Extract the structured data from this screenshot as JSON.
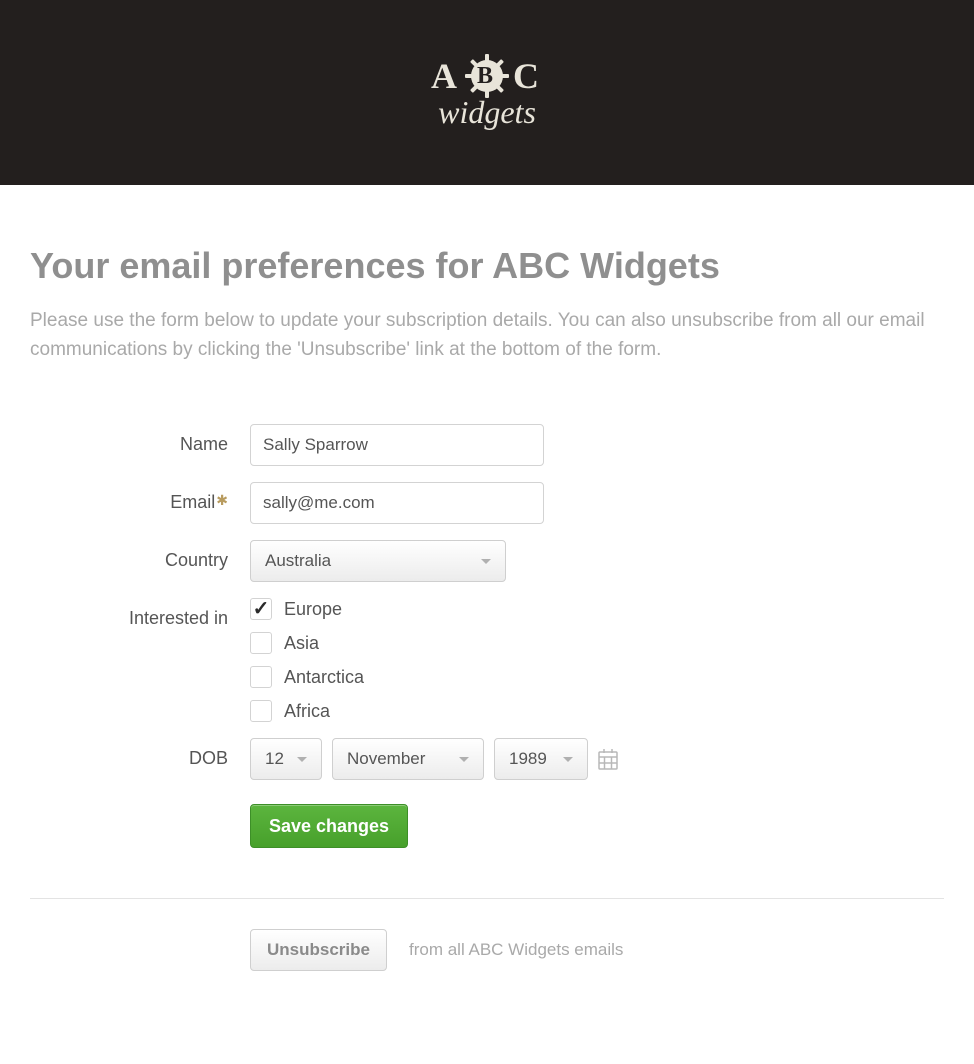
{
  "brand": {
    "line1_a": "A",
    "line1_b": "B",
    "line1_c": "C",
    "line2": "widgets"
  },
  "page": {
    "title": "Your email preferences for ABC Widgets",
    "intro": "Please use the form below to update your subscription details. You can also unsubscribe from all our email communications by clicking the 'Unsubscribe' link at the bottom of the form."
  },
  "form": {
    "name": {
      "label": "Name",
      "value": "Sally Sparrow"
    },
    "email": {
      "label": "Email",
      "value": "sally@me.com",
      "required": true
    },
    "country": {
      "label": "Country",
      "value": "Australia"
    },
    "interests": {
      "label": "Interested in",
      "options": [
        {
          "label": "Europe",
          "checked": true
        },
        {
          "label": "Asia",
          "checked": false
        },
        {
          "label": "Antarctica",
          "checked": false
        },
        {
          "label": "Africa",
          "checked": false
        }
      ]
    },
    "dob": {
      "label": "DOB",
      "day": "12",
      "month": "November",
      "year": "1989"
    },
    "save_label": "Save changes"
  },
  "unsubscribe": {
    "button": "Unsubscribe",
    "text": "from all ABC Widgets emails"
  }
}
